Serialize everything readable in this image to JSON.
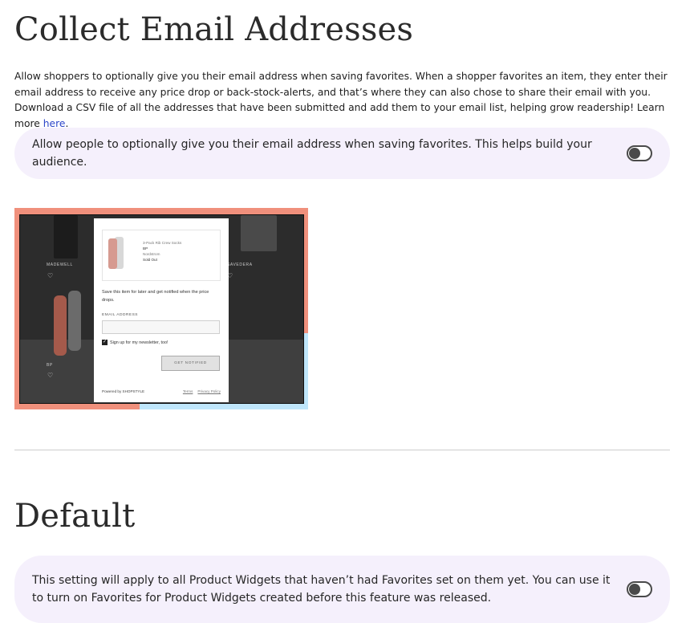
{
  "collect_section": {
    "title": "Collect Email Addresses",
    "description": "Allow shoppers to optionally give you their email address when saving favorites. When a shopper favorites an item, they enter their email address to receive any price drop or back-stock-alerts, and that’s where they can also chose to share their email with you. Download a CSV file of all the addresses that have been submitted and add them to your email list, helping grow readership! Learn more ",
    "learn_more_link": "here",
    "description_end": ".",
    "setting_text": "Allow people to optionally give you their email address when saving favorites. This helps build your audience.",
    "toggle_on": false
  },
  "preview": {
    "brand_left": "MADEWELL",
    "brand_right": "SAVEDERA",
    "brand_bottom": "BP",
    "heart_icon": "♡",
    "modal": {
      "product_name": "3-Pack Rib Crew Socks",
      "product_brand": "BP",
      "product_retailer": "Nordstrom",
      "product_status": "Sold Out",
      "message": "Save this item for later and get notified when the price drops.",
      "email_label": "EMAIL ADDRESS",
      "newsletter_label": "Sign up for my newsletter, too!",
      "newsletter_checked": true,
      "check_mark": "✓",
      "button_label": "GET NOTIFIED",
      "powered_by": "Powered by SHOPSTYLE",
      "terms": "Terms",
      "privacy": "Privacy Policy"
    }
  },
  "default_section": {
    "title": "Default",
    "setting_text": "This setting will apply to all Product Widgets that haven’t had Favorites set on them yet. You can use it to turn on Favorites for Product Widgets created before this feature was released.",
    "toggle_on": false
  },
  "colors": {
    "card_bg": "#f5f0fc",
    "link": "#2b45c9",
    "preview_coral": "#f0907c",
    "preview_blue": "#bfe6fb"
  }
}
